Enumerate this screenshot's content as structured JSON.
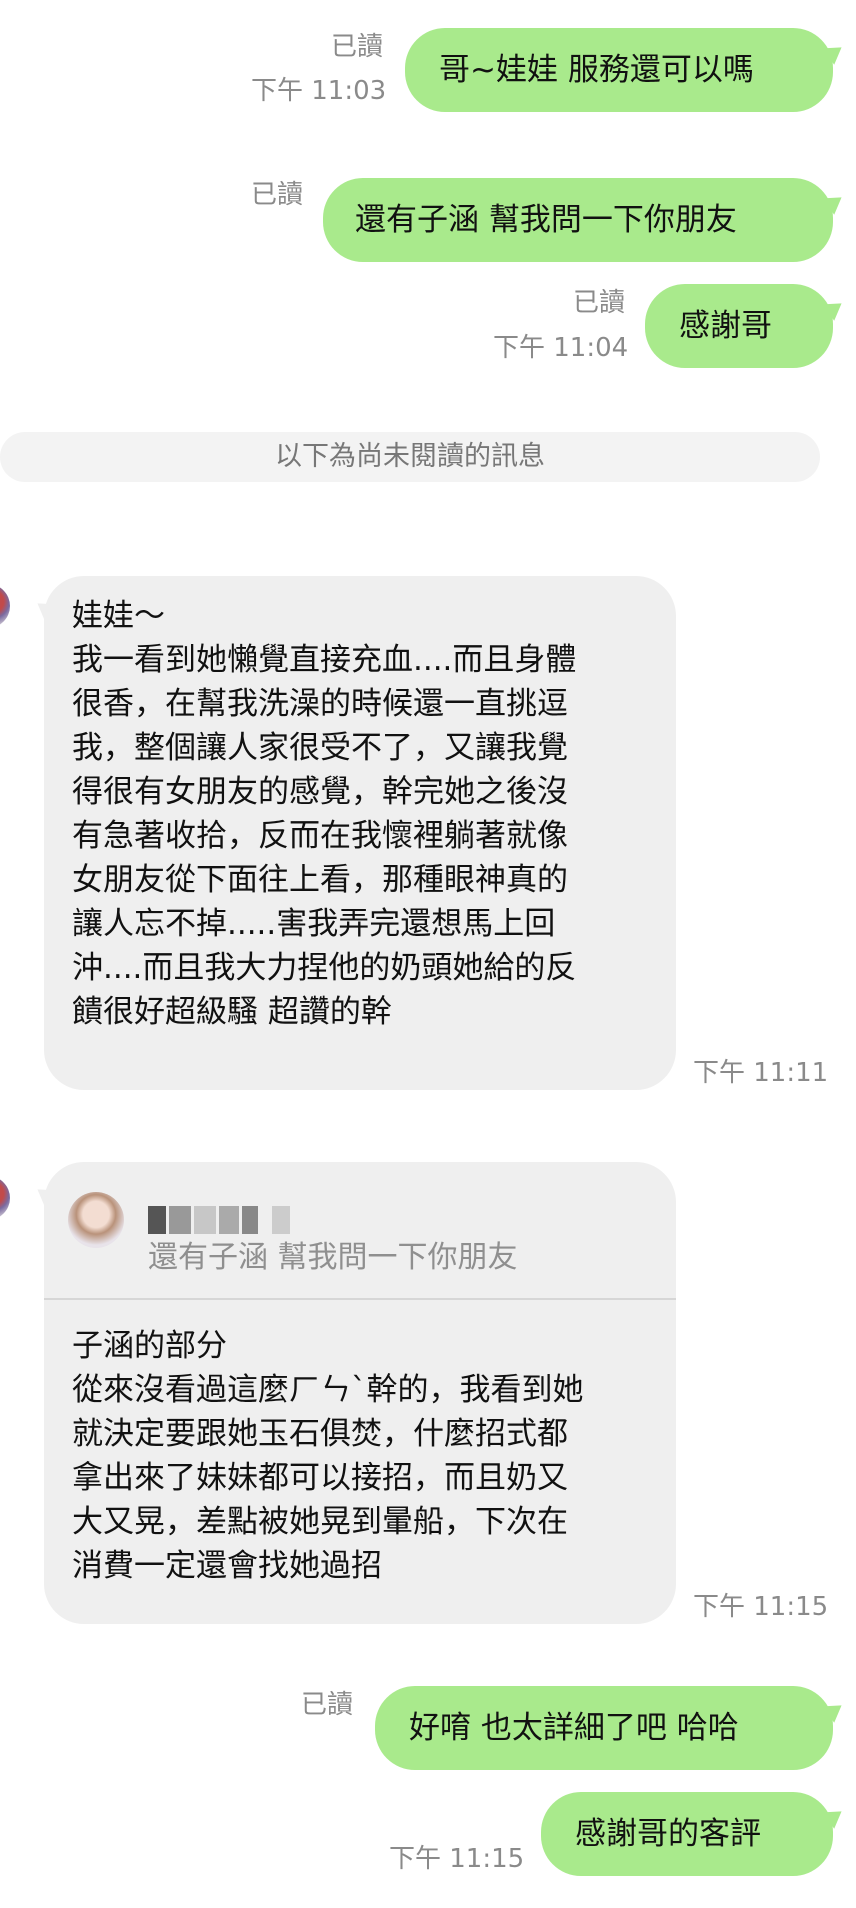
{
  "outgoing": [
    {
      "read": "已讀",
      "time": "下午 11:03",
      "text": "哥~娃娃 服務還可以嗎"
    },
    {
      "read": "已讀",
      "time": "",
      "text": "還有子涵 幫我問一下你朋友"
    },
    {
      "read": "已讀",
      "time": "下午 11:04",
      "text": "感謝哥"
    },
    {
      "read": "已讀",
      "time": "",
      "text": "好唷  也太詳細了吧 哈哈"
    },
    {
      "read": "",
      "time": "下午 11:15",
      "text": "感謝哥的客評"
    }
  ],
  "divider": "以下為尚未閱讀的訊息",
  "incoming1": {
    "time": "下午 11:11",
    "lines": [
      "娃娃～",
      "我一看到她懶覺直接充血....而且身體",
      "很香，在幫我洗澡的時候還一直挑逗",
      "我，整個讓人家很受不了，又讓我覺",
      "得很有女朋友的感覺，幹完她之後沒",
      "有急著收拾，反而在我懷裡躺著就像",
      "女朋友從下面往上看，那種眼神真的",
      "讓人忘不掉.....害我弄完還想馬上回",
      "沖....而且我大力捏他的奶頭她給的反",
      "饋很好超級騷 超讚的幹"
    ]
  },
  "incoming2": {
    "time": "下午 11:15",
    "quote_text": "還有子涵 幫我問一下你朋友",
    "lines": [
      "子涵的部分",
      "從來沒看過這麼ㄏㄣˋ幹的，我看到她",
      "就決定要跟她玉石俱焚，什麼招式都",
      "拿出來了妹妹都可以接招，而且奶又",
      "大又晃，差點被她晃到暈船，下次在",
      "消費一定還會找她過招"
    ]
  },
  "colors": {
    "outgoing_bubble": "#a9ea8c",
    "incoming_bubble": "#efefef",
    "meta_text": "#8a8a8a"
  }
}
